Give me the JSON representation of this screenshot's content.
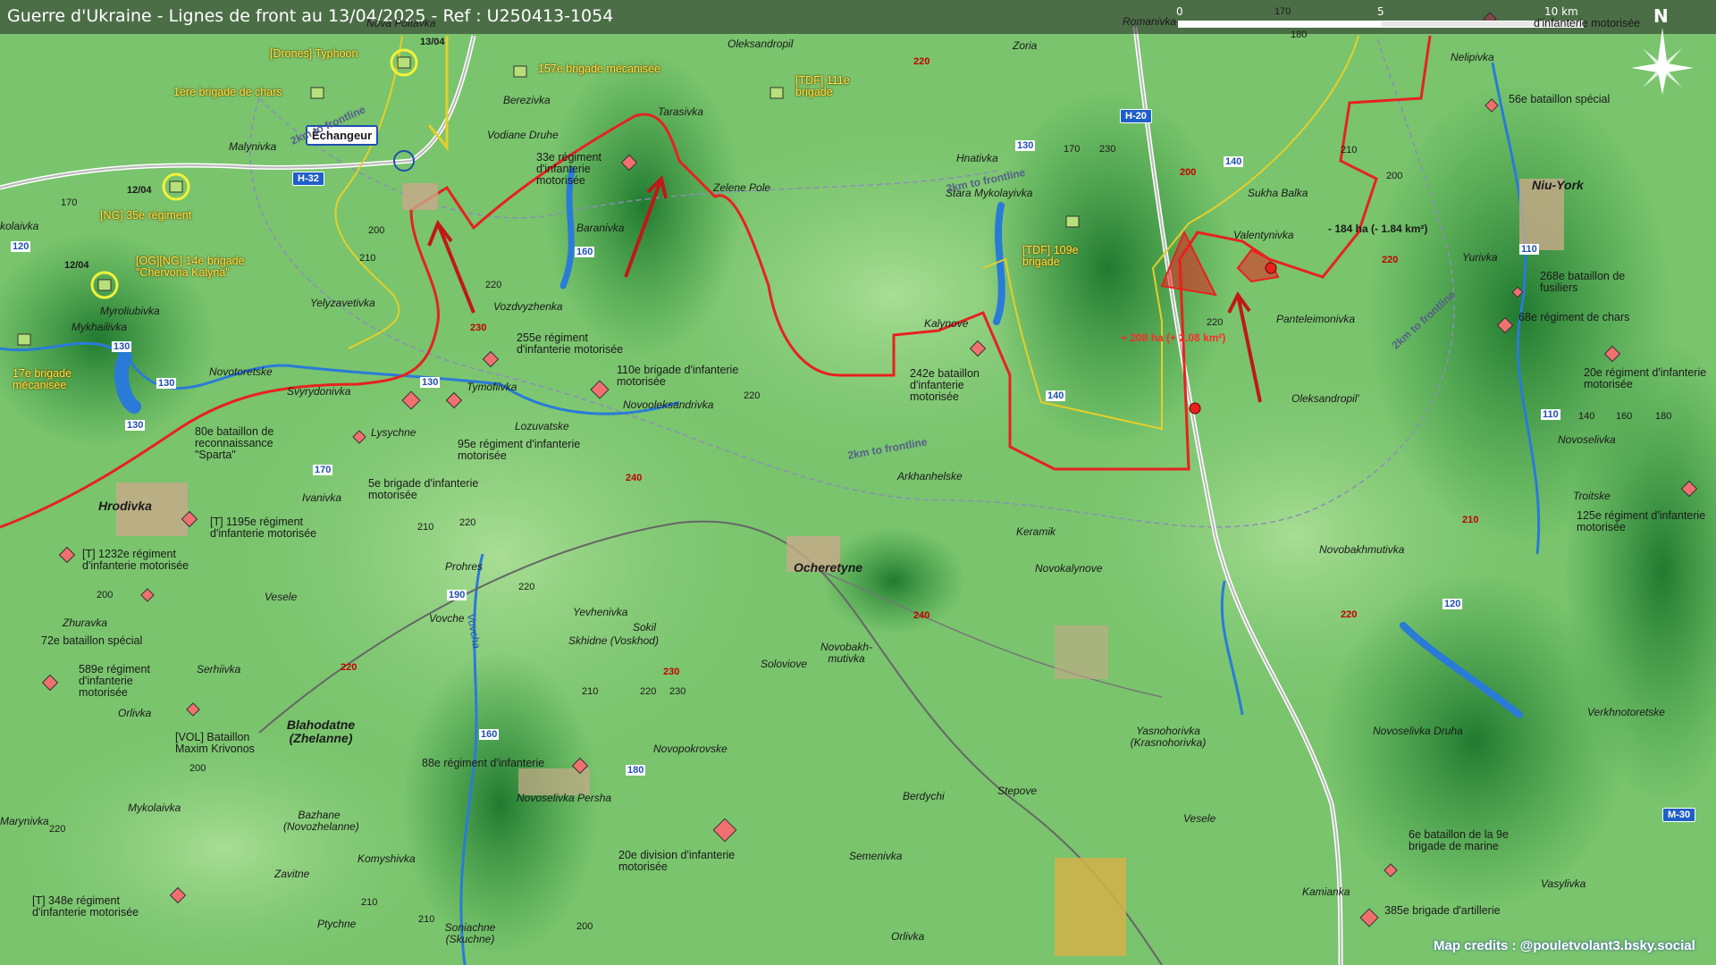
{
  "header": {
    "title": "Guerre d'Ukraine - Lignes de front au 13/04/2025 - Ref : U250413-1054"
  },
  "scale_bar": {
    "label_0": "0",
    "label_5": "5",
    "label_10": "10 km"
  },
  "compass": {
    "north": "N"
  },
  "credits": "Map credits : @pouletvolant3.bsky.social",
  "callout": {
    "label": "Échangeur"
  },
  "road_shields": [
    {
      "label": "H-32"
    },
    {
      "label": "H-20"
    },
    {
      "label": "M-30"
    }
  ],
  "route_numbers": [
    "130",
    "130",
    "130",
    "130",
    "120",
    "110",
    "110",
    "140",
    "140",
    "160",
    "160",
    "170",
    "180",
    "190",
    "120",
    "130"
  ],
  "towns": [
    "Nova Poltavka",
    "Oleksandropil",
    "Romanivka",
    "Zoria",
    "Nelipivka",
    "Berezivka",
    "Tarasivka",
    "Vodiane Druhe",
    "Malynivka",
    "Hnativka",
    "Stara Mykolayivka",
    "Zelene Pole",
    "Baranivka",
    "Sukha Balka",
    "Valentynivka",
    "Yurivka",
    "kolaivka",
    "Myroliubivka",
    "Mykhailivka",
    "Yelyzavetivka",
    "Vozdvyzhenka",
    "Kalynove",
    "Panteleimonivka",
    "Oleksandropil'",
    "Novotoretske",
    "Svyrydonivka",
    "Tymofiivka",
    "Novooleksandrivka",
    "Lozuvatske",
    "Lysychne",
    "Arkhanhelske",
    "Novoselivka",
    "Troitske",
    "Ivanivka",
    "Keramik",
    "Novokalynove",
    "Novobakhmutivka",
    "Prohres",
    "Vesele",
    "Zhuravka",
    "Yevhenivka",
    "Skhidne (Voskhod)",
    "Sokil",
    "Novobakh-mutivka",
    "Soloviove",
    "Vovche",
    "Serhiivka",
    "Orlivka",
    "Yasnohorivka (Krasnohorivka)",
    "Novoselivka Druha",
    "Verkhnotoretske",
    "Novopokrovske",
    "Novoselivka Persha",
    "Berdychi",
    "Stepove",
    "Mykolaivka",
    "Bazhane (Novozhelanne)",
    "Marynivka",
    "Komyshivka",
    "Semenivka",
    "Vesele",
    "Zavitne",
    "Kamianka",
    "Vasylivka",
    "Ptychne",
    "Soniachne (Skuchne)",
    "Orlivka",
    "Vovcha"
  ],
  "big_towns": [
    "Hrodivka",
    "Ocheretyne",
    "Blahodatne (Zhelanne)",
    "Niu-York"
  ],
  "units_yellow": [
    {
      "text": "[Drones] Typhoon"
    },
    {
      "text": "1ère brigade de chars"
    },
    {
      "text": "157e brigade mécanisée"
    },
    {
      "text": "[TDF] 111e brigade"
    },
    {
      "text": "[NG] 35e régiment"
    },
    {
      "text": "[OG][NG] 14e brigade \"Chervona Kalyna\""
    },
    {
      "text": "17e brigade mécanisée"
    },
    {
      "text": "[TDF] 109e brigade"
    }
  ],
  "units_black": [
    {
      "text": "33e régiment d'infanterie motorisée"
    },
    {
      "text": "255e régiment d'infanterie motorisée"
    },
    {
      "text": "110e brigade d'infanterie motorisée"
    },
    {
      "text": "242e bataillon d'infanterie motorisée"
    },
    {
      "text": "80e bataillon de reconnaissance \"Sparta\""
    },
    {
      "text": "95e régiment d'infanterie motorisée"
    },
    {
      "text": "5e brigade d'infanterie motorisée"
    },
    {
      "text": "[T] 1195e régiment d'infanterie motorisée"
    },
    {
      "text": "[T] 1232e régiment d'infanterie motorisée"
    },
    {
      "text": "72e bataillon spécial"
    },
    {
      "text": "589e régiment d'infanterie motorisée"
    },
    {
      "text": "[VOL] Bataillon Maxim Krivonos"
    },
    {
      "text": "88e régiment d'infanterie"
    },
    {
      "text": "20e division d'infanterie motorisée"
    },
    {
      "text": "[T] 348e régiment d'infanterie motorisée"
    },
    {
      "text": "d'infanterie motorisée"
    },
    {
      "text": "56e bataillon spécial"
    },
    {
      "text": "268e bataillon de fusiliers"
    },
    {
      "text": "68e régiment de chars"
    },
    {
      "text": "20e régiment d'infanterie motorisée"
    },
    {
      "text": "125e régiment d'infanterie motorisée"
    },
    {
      "text": "6e bataillon de la 9e brigade de marine"
    },
    {
      "text": "385e brigade d'artillerie"
    }
  ],
  "area_changes": [
    {
      "text": "- 184 ha (- 1.84 km²)"
    },
    {
      "text": "+ 208 ha (+ 2.08 km²)"
    }
  ],
  "frontline_buffer_labels": [
    "2km to frontline",
    "2km to frontline",
    "2km to frontline",
    "2km to frontline"
  ],
  "dates": [
    "13/04",
    "12/04",
    "12/04"
  ],
  "altitudes_black": [
    "170",
    "180",
    "170",
    "200",
    "210",
    "220",
    "210",
    "200",
    "220",
    "170",
    "230",
    "210",
    "220",
    "220",
    "210",
    "200",
    "140",
    "160",
    "220",
    "220",
    "180",
    "220",
    "210",
    "200",
    "230",
    "220",
    "210",
    "210",
    "200",
    "200",
    "200",
    "170",
    "180",
    "200"
  ],
  "altitudes_red": [
    "220",
    "230",
    "240",
    "200",
    "240",
    "240",
    "240",
    "230",
    "220",
    "220",
    "210",
    "220"
  ],
  "colors": {
    "frontline_red": "#e8211f",
    "yellow_line": "#e6cf2a",
    "forest_dark": "#2f8f3a",
    "field_light": "#8fd07f",
    "road_shield_blue": "#1f5fc8",
    "russian_unit": "#f07070",
    "ukrainian_unit": "#b6e07a"
  }
}
